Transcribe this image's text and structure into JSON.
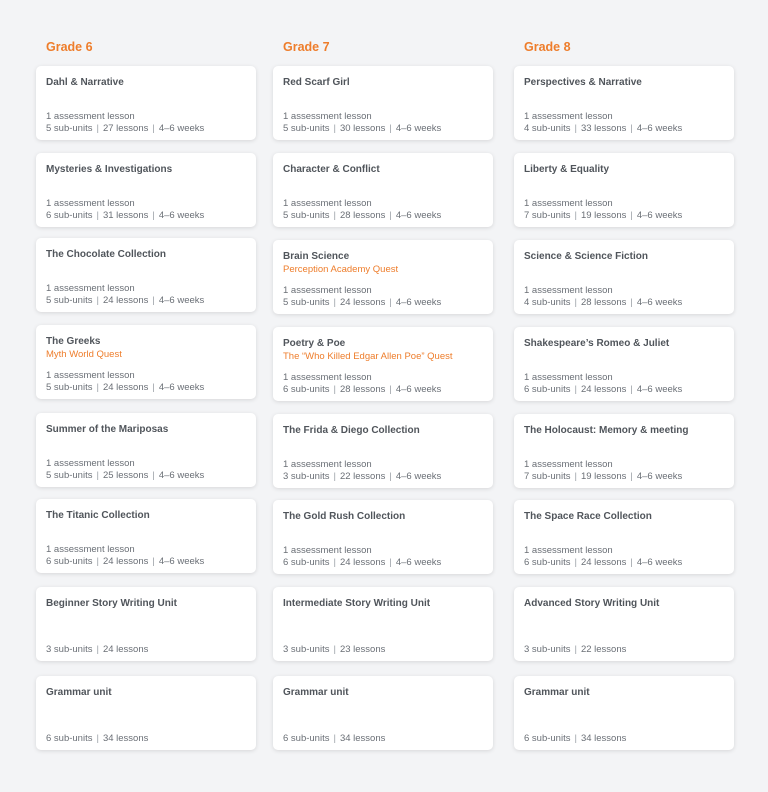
{
  "columns": [
    {
      "grade": "Grade 6",
      "units": [
        {
          "title": "Dahl & Narrative",
          "quest": "",
          "assessment": "1 assessment lesson",
          "subunits": "5 sub-units",
          "lessons": "27 lessons",
          "weeks": "4–6 weeks"
        },
        {
          "title": "Mysteries & Investigations",
          "quest": "",
          "assessment": "1 assessment lesson",
          "subunits": "6 sub-units",
          "lessons": "31 lessons",
          "weeks": "4–6 weeks"
        },
        {
          "title": "The Chocolate Collection",
          "quest": "",
          "assessment": "1 assessment lesson",
          "subunits": "5 sub-units",
          "lessons": "24 lessons",
          "weeks": "4–6 weeks"
        },
        {
          "title": "The Greeks",
          "quest": "Myth World Quest",
          "assessment": "1 assessment lesson",
          "subunits": "5 sub-units",
          "lessons": "24 lessons",
          "weeks": "4–6 weeks"
        },
        {
          "title": "Summer of the Mariposas",
          "quest": "",
          "assessment": "1 assessment lesson",
          "subunits": "5 sub-units",
          "lessons": "25 lessons",
          "weeks": "4–6 weeks"
        },
        {
          "title": "The Titanic Collection",
          "quest": "",
          "assessment": "1 assessment lesson",
          "subunits": "6 sub-units",
          "lessons": "24 lessons",
          "weeks": "4–6 weeks"
        },
        {
          "title": "Beginner Story Writing Unit",
          "quest": "",
          "assessment": "",
          "subunits": "3 sub-units",
          "lessons": "24 lessons",
          "weeks": ""
        },
        {
          "title": "Grammar unit",
          "quest": "",
          "assessment": "",
          "subunits": "6 sub-units",
          "lessons": "34 lessons",
          "weeks": ""
        }
      ]
    },
    {
      "grade": "Grade 7",
      "units": [
        {
          "title": "Red Scarf Girl",
          "quest": "",
          "assessment": "1 assessment lesson",
          "subunits": "5 sub-units",
          "lessons": "30 lessons",
          "weeks": "4–6 weeks"
        },
        {
          "title": "Character & Conflict",
          "quest": "",
          "assessment": "1 assessment lesson",
          "subunits": "5 sub-units",
          "lessons": "28 lessons",
          "weeks": "4–6 weeks"
        },
        {
          "title": "Brain Science",
          "quest": "Perception Academy Quest",
          "assessment": "1 assessment lesson",
          "subunits": "5 sub-units",
          "lessons": "24 lessons",
          "weeks": "4–6 weeks"
        },
        {
          "title": "Poetry & Poe",
          "quest": "The “Who Killed Edgar Allen Poe” Quest",
          "assessment": "1 assessment lesson",
          "subunits": "6 sub-units",
          "lessons": "28 lessons",
          "weeks": "4–6 weeks"
        },
        {
          "title": "The Frida & Diego Collection",
          "quest": "",
          "assessment": "1 assessment lesson",
          "subunits": "3 sub-units",
          "lessons": "22 lessons",
          "weeks": "4–6 weeks"
        },
        {
          "title": "The Gold Rush Collection",
          "quest": "",
          "assessment": "1 assessment lesson",
          "subunits": "6 sub-units",
          "lessons": "24 lessons",
          "weeks": "4–6 weeks"
        },
        {
          "title": "Intermediate Story Writing Unit",
          "quest": "",
          "assessment": "",
          "subunits": "3 sub-units",
          "lessons": "23 lessons",
          "weeks": ""
        },
        {
          "title": "Grammar unit",
          "quest": "",
          "assessment": "",
          "subunits": "6 sub-units",
          "lessons": "34 lessons",
          "weeks": ""
        }
      ]
    },
    {
      "grade": "Grade 8",
      "units": [
        {
          "title": "Perspectives & Narrative",
          "quest": "",
          "assessment": "1 assessment lesson",
          "subunits": "4 sub-units",
          "lessons": "33 lessons",
          "weeks": "4–6 weeks"
        },
        {
          "title": "Liberty & Equality",
          "quest": "",
          "assessment": "1 assessment lesson",
          "subunits": "7 sub-units",
          "lessons": "19 lessons",
          "weeks": "4–6 weeks"
        },
        {
          "title": "Science & Science Fiction",
          "quest": "",
          "assessment": "1 assessment lesson",
          "subunits": "4 sub-units",
          "lessons": "28 lessons",
          "weeks": "4–6 weeks"
        },
        {
          "title": "Shakespeare’s Romeo & Juliet",
          "quest": "",
          "assessment": "1 assessment lesson",
          "subunits": "6 sub-units",
          "lessons": "24 lessons",
          "weeks": "4–6 weeks"
        },
        {
          "title": "The Holocaust: Memory & meeting",
          "quest": "",
          "assessment": "1 assessment lesson",
          "subunits": "7 sub-units",
          "lessons": "19 lessons",
          "weeks": "4–6 weeks"
        },
        {
          "title": "The Space Race Collection",
          "quest": "",
          "assessment": "1 assessment lesson",
          "subunits": "6 sub-units",
          "lessons": "24 lessons",
          "weeks": "4–6 weeks"
        },
        {
          "title": "Advanced Story Writing Unit",
          "quest": "",
          "assessment": "",
          "subunits": "3 sub-units",
          "lessons": "22 lessons",
          "weeks": ""
        },
        {
          "title": "Grammar unit",
          "quest": "",
          "assessment": "",
          "subunits": "6 sub-units",
          "lessons": "34 lessons",
          "weeks": ""
        }
      ]
    }
  ],
  "colors": {
    "accent": "#ee7d2b",
    "background": "#f3f4f6",
    "card": "#ffffff"
  }
}
